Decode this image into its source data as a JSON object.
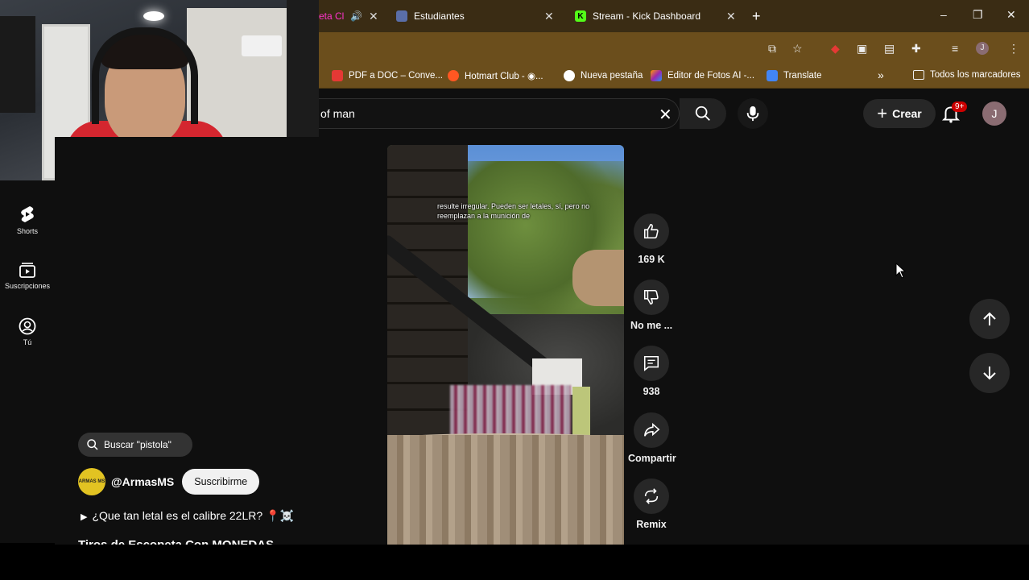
{
  "browser": {
    "tabs": [
      {
        "label": "eta Cl",
        "favicon_color": "#ff4444"
      },
      {
        "label": "Estudiantes",
        "favicon_color": "#5a6ea8"
      },
      {
        "label": "Stream - Kick Dashboard",
        "favicon_color": "#53fc18",
        "favicon_text": "K"
      }
    ],
    "new_tab": "+",
    "window_controls": [
      "–",
      "❐",
      "✕"
    ],
    "bookmarks": [
      {
        "label": "PDF a DOC – Conve...",
        "color": "#e53935"
      },
      {
        "label": "Hotmart Club - ◉...",
        "color": "#ff5722"
      },
      {
        "label": "Nueva pestaña",
        "color": "#ffffff"
      },
      {
        "label": "Editor de Fotos AI -...",
        "color": "#9c27b0"
      },
      {
        "label": "Translate",
        "color": "#4285f4"
      }
    ],
    "bookmarks_overflow": "»",
    "all_bookmarks": "Todos los marcadores"
  },
  "youtube": {
    "search_query": "of man",
    "create_label": "Crear",
    "notif_count": "9+",
    "avatar_initial": "J"
  },
  "sidebar": {
    "items": [
      {
        "label": "Shorts",
        "icon": "shorts-icon"
      },
      {
        "label": "Suscripciones",
        "icon": "subscriptions-icon"
      },
      {
        "label": "Tú",
        "icon": "you-icon"
      }
    ]
  },
  "short": {
    "caption": "resulte irregular. Pueden ser letales, sí, pero no reemplazan a la munición de",
    "likes": "169 K",
    "dislike_label": "No me ...",
    "comments": "938",
    "share_label": "Compartir",
    "remix_label": "Remix",
    "search_chip": "Buscar \"pistola\"",
    "channel_name": "@ArmasMS",
    "channel_avatar_text": "ARMAS MS",
    "subscribe_label": "Suscribirme",
    "title": "¿Que tan letal es el calibre 22LR? 📍☠️",
    "subtitle": "Tiros de Escopeta Con MONEDAS"
  }
}
